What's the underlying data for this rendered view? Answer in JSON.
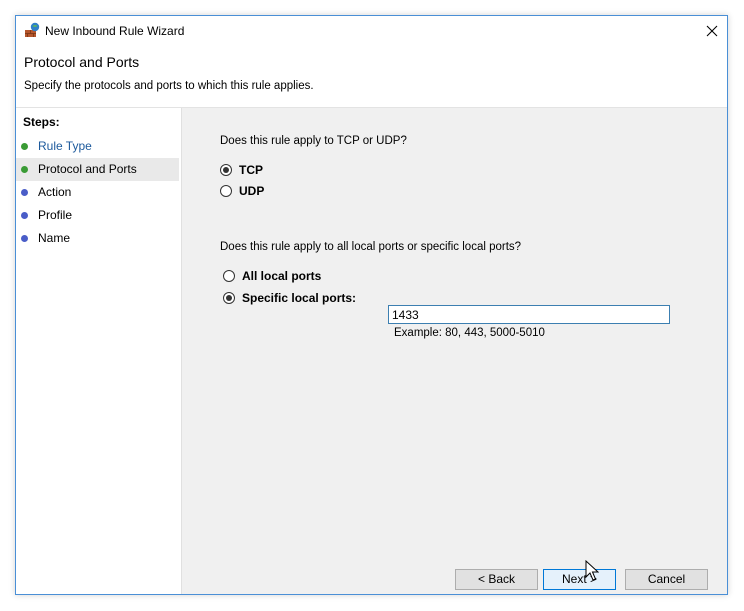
{
  "window": {
    "title": "New Inbound Rule Wizard"
  },
  "header": {
    "title": "Protocol and Ports",
    "subtitle": "Specify the protocols and ports to which this rule applies."
  },
  "sidebar": {
    "steps_label": "Steps:",
    "items": [
      {
        "label": "Rule Type",
        "bullet_color": "#3a9b35",
        "link_color": "#1d5a9c"
      },
      {
        "label": "Protocol and Ports",
        "bullet_color": "#3a9b35",
        "link_color": "#000000"
      },
      {
        "label": "Action",
        "bullet_color": "#4a5dc8",
        "link_color": "#000000"
      },
      {
        "label": "Profile",
        "bullet_color": "#4a5dc8",
        "link_color": "#000000"
      },
      {
        "label": "Name",
        "bullet_color": "#4a5dc8",
        "link_color": "#000000"
      }
    ]
  },
  "protocol": {
    "question": "Does this rule apply to TCP or UDP?",
    "options": [
      {
        "label": "TCP",
        "selected": true
      },
      {
        "label": "UDP",
        "selected": false
      }
    ]
  },
  "ports": {
    "question": "Does this rule apply to all local ports or specific local ports?",
    "all_label": "All local ports",
    "specific_label": "Specific local ports:",
    "specific_selected": true,
    "value": "1433",
    "example": "Example: 80, 443, 5000-5010"
  },
  "buttons": {
    "back": "< Back",
    "next": "Next >",
    "cancel": "Cancel"
  },
  "icons": {
    "app": "firewall-wizard-icon",
    "close": "close-icon",
    "cursor": "mouse-pointer-icon"
  }
}
